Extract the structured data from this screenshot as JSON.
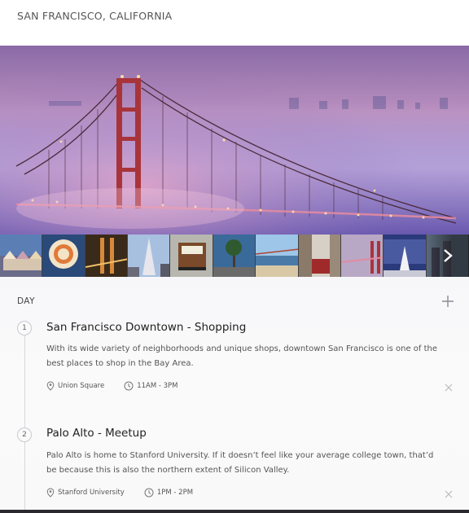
{
  "header": {
    "location": "SAN FRANCISCO, CALIFORNIA"
  },
  "gallery": {
    "hero_icon": "golden-gate-bridge-photo",
    "thumbnails": [
      "painted-ladies-photo",
      "sf-seal-photo",
      "bridge-night-photo",
      "transamerica-photo",
      "cable-car-photo",
      "palm-street-photo",
      "beach-bridge-photo",
      "downtown-street-photo",
      "bridge-fog-photo",
      "union-square-photo",
      "city-skyline-photo"
    ]
  },
  "itinerary": {
    "day_label": "DAY",
    "items": [
      {
        "number": "1",
        "title": "San Francisco Downtown - Shopping",
        "description": "With its wide variety of neighborhoods and unique shops, downtown San Francisco is one of the best places to shop in the Bay Area.",
        "location": "Union Square",
        "time": "11AM - 3PM"
      },
      {
        "number": "2",
        "title": "Palo Alto - Meetup",
        "description": "Palo Alto is home to Stanford University. If it doesn’t feel like your average college town, that’d be because this is also the northern extent of Silicon Valley.",
        "location": "Stanford University",
        "time": "1PM - 2PM"
      }
    ]
  }
}
